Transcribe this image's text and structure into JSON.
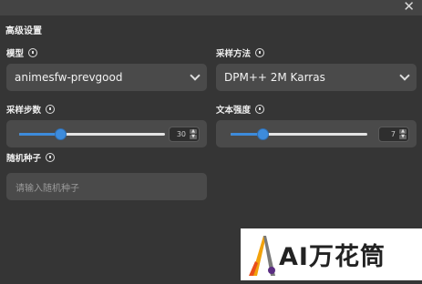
{
  "dialog": {
    "title": "高级设置",
    "close_icon": "close-icon"
  },
  "model": {
    "label": "模型",
    "value": "animesfw-prevgood"
  },
  "sampler": {
    "label": "采样方法",
    "value": "DPM++ 2M Karras"
  },
  "steps": {
    "label": "采样步数",
    "value": "30",
    "slider_fraction": 0.28
  },
  "cfg": {
    "label": "文本强度",
    "value": "7",
    "slider_fraction": 0.23
  },
  "seed": {
    "label": "随机种子",
    "placeholder": "请输入随机种子"
  },
  "watermark": {
    "text": "AI万花筒"
  },
  "colors": {
    "accent": "#3d8bdb",
    "background": "#353535",
    "field": "#4a4a4a"
  }
}
